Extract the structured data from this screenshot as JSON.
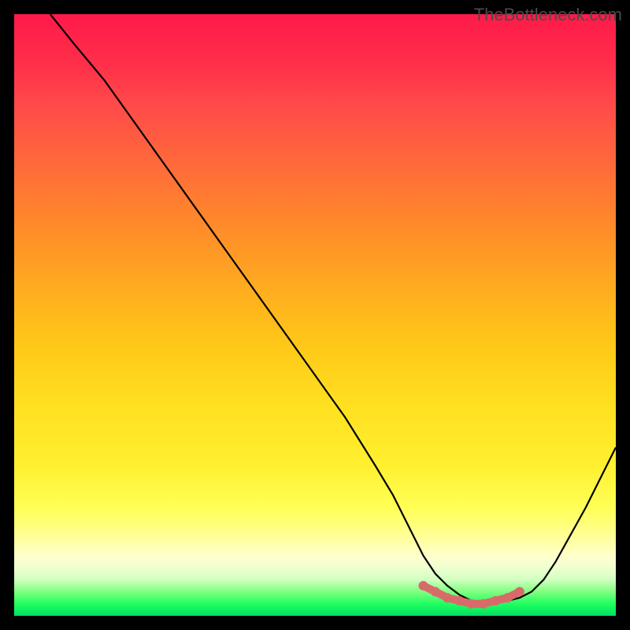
{
  "watermark": "TheBottleneck.com",
  "chart_data": {
    "type": "line",
    "title": "",
    "xlabel": "",
    "ylabel": "",
    "xlim": [
      0,
      100
    ],
    "ylim": [
      0,
      100
    ],
    "grid": false,
    "series": [
      {
        "name": "bottleneck-curve",
        "x": [
          6,
          10,
          15,
          20,
          25,
          30,
          35,
          40,
          45,
          50,
          55,
          60,
          63,
          66,
          68,
          70,
          72,
          74,
          76,
          78,
          80,
          82,
          84,
          86,
          88,
          90,
          95,
          100
        ],
        "y": [
          100,
          95,
          89,
          82,
          75,
          68,
          61,
          54,
          47,
          40,
          33,
          25,
          20,
          14,
          10,
          7,
          5,
          3.5,
          2.5,
          2,
          2,
          2.5,
          3,
          4,
          6,
          9,
          18,
          28
        ]
      }
    ],
    "optimal_markers": {
      "x": [
        68,
        70,
        72,
        74,
        76,
        78,
        80,
        82,
        84
      ],
      "y": [
        5,
        4,
        3,
        2.5,
        2,
        2,
        2.5,
        3,
        4
      ]
    },
    "colors": {
      "curve": "#000000",
      "markers": "#d96a6a",
      "gradient_top": "#ff1a4a",
      "gradient_bottom": "#00e060"
    }
  }
}
